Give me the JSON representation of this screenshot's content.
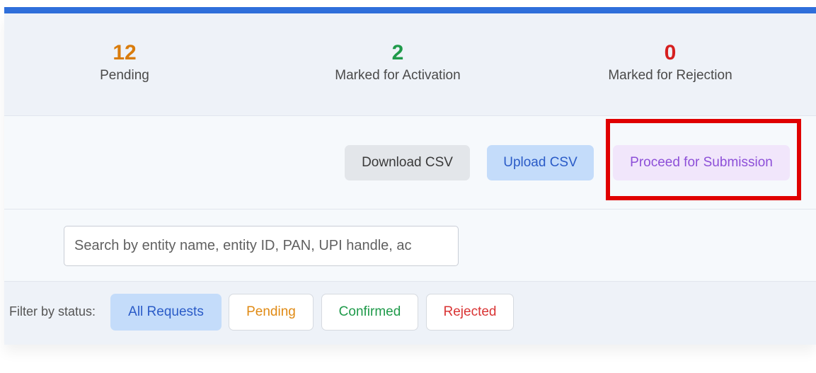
{
  "stats": {
    "pending": {
      "value": "12",
      "label": "Pending",
      "color": "#d97c0c"
    },
    "activation": {
      "value": "2",
      "label": "Marked for Activation",
      "color": "#1f9a4a"
    },
    "rejection": {
      "value": "0",
      "label": "Marked for Rejection",
      "color": "#d61f1f"
    }
  },
  "actions": {
    "download_label": "Download CSV",
    "upload_label": "Upload CSV",
    "proceed_label": "Proceed for Submission"
  },
  "search": {
    "placeholder": "Search by entity name, entity ID, PAN, UPI handle, ac",
    "value": ""
  },
  "filter": {
    "label": "Filter by status:",
    "options": [
      {
        "label": "All Requests",
        "selected": true
      },
      {
        "label": "Pending",
        "selected": false
      },
      {
        "label": "Confirmed",
        "selected": false
      },
      {
        "label": "Rejected",
        "selected": false
      }
    ]
  },
  "colors": {
    "accent": "#2f6fdb",
    "highlight": "#e00000"
  }
}
